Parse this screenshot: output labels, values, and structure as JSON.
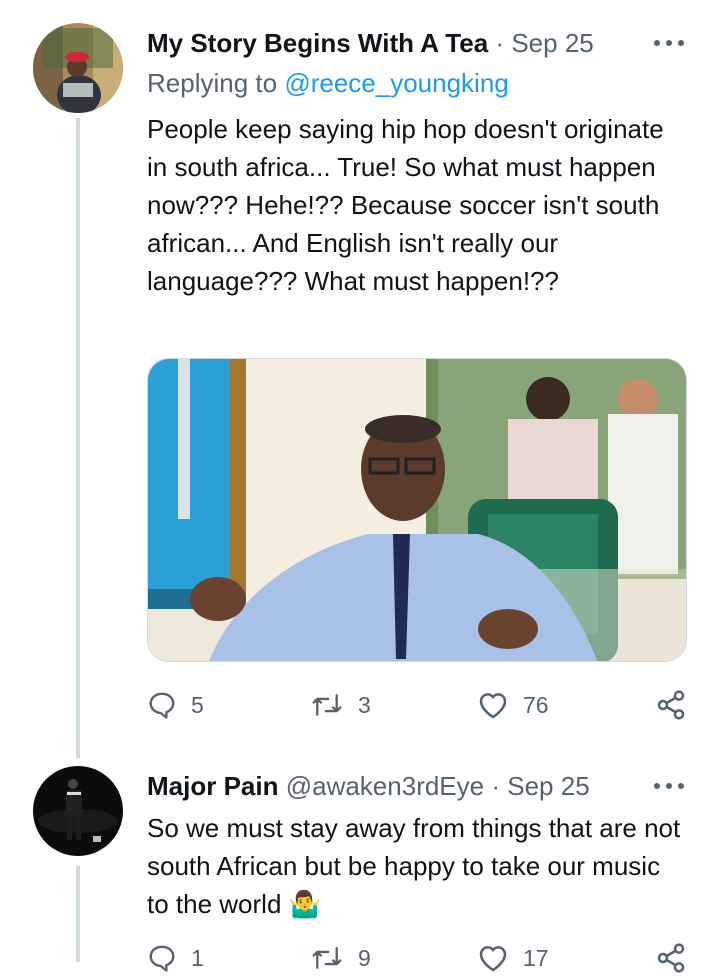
{
  "tweets": [
    {
      "author_name": "My Story Begins With A Tea",
      "date": "Sep 25",
      "separator": "·",
      "replying_prefix": "Replying to ",
      "replying_handle": "@reece_youngking",
      "text": "People keep saying hip hop doesn't originate in south africa... True! So what must happen now??? Hehe!?? Because soccer isn't south african... And English isn't really our language??? What must happen!??",
      "stats": {
        "replies": "5",
        "retweets": "3",
        "likes": "76"
      }
    },
    {
      "author_name": "Major Pain",
      "handle": "@awaken3rdEye",
      "date": "Sep 25",
      "separator": "·",
      "text": "So we must stay away from things that are not south African but be happy to take our music to the world",
      "emoji": "🤷‍♂️",
      "stats": {
        "replies": "1",
        "retweets": "9",
        "likes": "17"
      }
    }
  ],
  "colors": {
    "accent": "#1d9bf0",
    "muted": "#536471",
    "text": "#0f1419",
    "line": "#cfd9de"
  },
  "icons": [
    "reply-icon",
    "retweet-icon",
    "like-icon",
    "share-icon",
    "more-icon"
  ]
}
